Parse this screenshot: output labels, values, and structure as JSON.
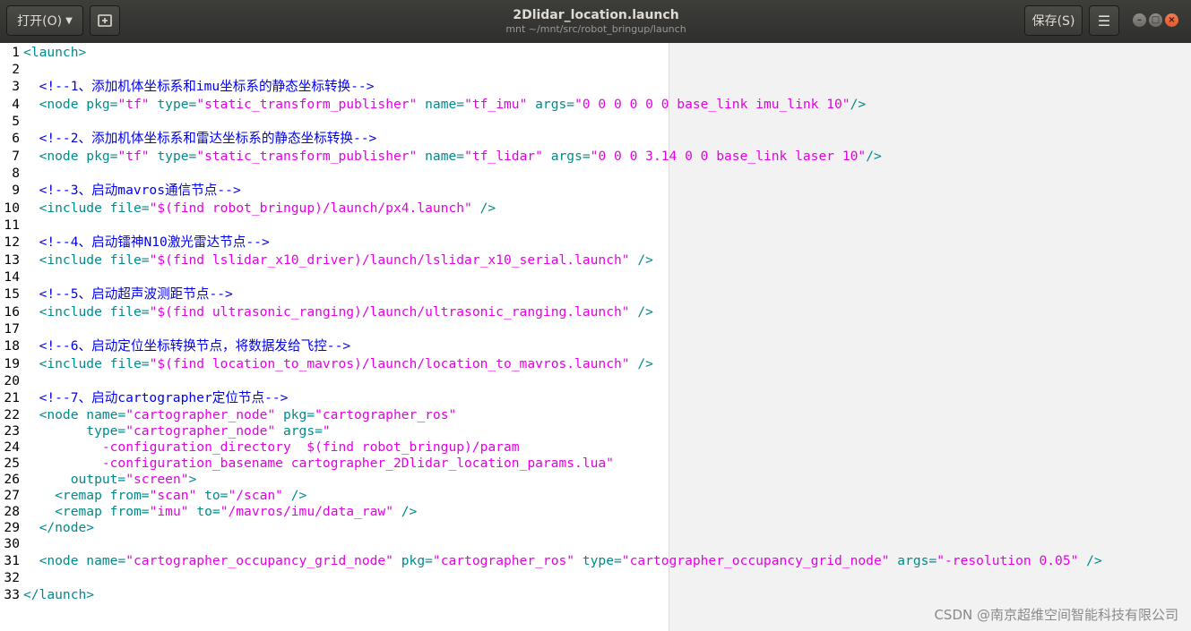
{
  "header": {
    "open_label": "打开(O)",
    "save_label": "保存(S)",
    "title": "2Dlidar_location.launch",
    "subtitle": "mnt ~/mnt/src/robot_bringup/launch"
  },
  "editor": {
    "lines": [
      {
        "n": "1",
        "h": "full",
        "segs": [
          [
            "tag",
            "<launch>"
          ]
        ]
      },
      {
        "n": "2",
        "h": "half",
        "segs": []
      },
      {
        "n": "3",
        "h": "full",
        "segs": [
          [
            "tag",
            "  "
          ],
          [
            "com",
            "<!--1、添加机体坐标系和imu坐标系的静态坐标转换-->"
          ]
        ]
      },
      {
        "n": "4",
        "h": "full",
        "segs": [
          [
            "tag",
            "  <node "
          ],
          [
            "attr",
            "pkg="
          ],
          [
            "str",
            "\"tf\""
          ],
          [
            "attr",
            " type="
          ],
          [
            "str",
            "\"static_transform_publisher\""
          ],
          [
            "attr",
            " name="
          ],
          [
            "str",
            "\"tf_imu\""
          ],
          [
            "attr",
            " args="
          ],
          [
            "str",
            "\"0 0 0 0 0 0 base_link imu_link 10\""
          ],
          [
            "tag",
            "/>"
          ]
        ]
      },
      {
        "n": "5",
        "h": "half",
        "segs": []
      },
      {
        "n": "6",
        "h": "full",
        "segs": [
          [
            "tag",
            "  "
          ],
          [
            "com",
            "<!--2、添加机体坐标系和雷达坐标系的静态坐标转换-->"
          ]
        ]
      },
      {
        "n": "7",
        "h": "full",
        "segs": [
          [
            "tag",
            "  <node "
          ],
          [
            "attr",
            "pkg="
          ],
          [
            "str",
            "\"tf\""
          ],
          [
            "attr",
            " type="
          ],
          [
            "str",
            "\"static_transform_publisher\""
          ],
          [
            "attr",
            " name="
          ],
          [
            "str",
            "\"tf_lidar\""
          ],
          [
            "attr",
            " args="
          ],
          [
            "str",
            "\"0 0 0 3.14 0 0 base_link laser 10\""
          ],
          [
            "tag",
            "/>"
          ]
        ]
      },
      {
        "n": "8",
        "h": "half",
        "segs": []
      },
      {
        "n": "9",
        "h": "full",
        "segs": [
          [
            "tag",
            "  "
          ],
          [
            "com",
            "<!--3、启动mavros通信节点-->"
          ]
        ]
      },
      {
        "n": "10",
        "h": "full",
        "segs": [
          [
            "tag",
            "  <include "
          ],
          [
            "attr",
            "file="
          ],
          [
            "str",
            "\"$(find robot_bringup)/launch/px4.launch\""
          ],
          [
            "tag",
            " />"
          ]
        ]
      },
      {
        "n": "11",
        "h": "half",
        "segs": []
      },
      {
        "n": "12",
        "h": "full",
        "segs": [
          [
            "tag",
            "  "
          ],
          [
            "com",
            "<!--4、启动镭神N10激光雷达节点-->"
          ]
        ]
      },
      {
        "n": "13",
        "h": "full",
        "segs": [
          [
            "tag",
            "  <include "
          ],
          [
            "attr",
            "file="
          ],
          [
            "str",
            "\"$(find lslidar_x10_driver)/launch/lslidar_x10_serial.launch\""
          ],
          [
            "tag",
            " />"
          ]
        ]
      },
      {
        "n": "14",
        "h": "half",
        "segs": []
      },
      {
        "n": "15",
        "h": "full",
        "segs": [
          [
            "tag",
            "  "
          ],
          [
            "com",
            "<!--5、启动超声波测距节点-->"
          ]
        ]
      },
      {
        "n": "16",
        "h": "full",
        "segs": [
          [
            "tag",
            "  <include "
          ],
          [
            "attr",
            "file="
          ],
          [
            "str",
            "\"$(find ultrasonic_ranging)/launch/ultrasonic_ranging.launch\""
          ],
          [
            "tag",
            " />"
          ]
        ]
      },
      {
        "n": "17",
        "h": "half",
        "segs": []
      },
      {
        "n": "18",
        "h": "full",
        "segs": [
          [
            "tag",
            "  "
          ],
          [
            "com",
            "<!--6、启动定位坐标转换节点，将数据发给飞控-->"
          ]
        ]
      },
      {
        "n": "19",
        "h": "full",
        "segs": [
          [
            "tag",
            "  <include "
          ],
          [
            "attr",
            "file="
          ],
          [
            "str",
            "\"$(find location_to_mavros)/launch/location_to_mavros.launch\""
          ],
          [
            "tag",
            " />"
          ]
        ]
      },
      {
        "n": "20",
        "h": "half",
        "segs": []
      },
      {
        "n": "21",
        "h": "full",
        "segs": [
          [
            "tag",
            "  "
          ],
          [
            "com",
            "<!--7、启动cartographer定位节点-->"
          ]
        ]
      },
      {
        "n": "22",
        "h": "half",
        "segs": [
          [
            "tag",
            "  <node "
          ],
          [
            "attr",
            "name="
          ],
          [
            "str",
            "\"cartographer_node\""
          ],
          [
            "attr",
            " pkg="
          ],
          [
            "str",
            "\"cartographer_ros\""
          ]
        ]
      },
      {
        "n": "23",
        "h": "half",
        "segs": [
          [
            "attr",
            "        type="
          ],
          [
            "str",
            "\"cartographer_node\""
          ],
          [
            "attr",
            " args="
          ],
          [
            "str",
            "\""
          ]
        ]
      },
      {
        "n": "24",
        "h": "half",
        "segs": [
          [
            "str",
            "          -configuration_directory  $(find robot_bringup)/param"
          ]
        ]
      },
      {
        "n": "25",
        "h": "half",
        "segs": [
          [
            "str",
            "          -configuration_basename cartographer_2Dlidar_location_params.lua\""
          ]
        ]
      },
      {
        "n": "26",
        "h": "half",
        "segs": [
          [
            "attr",
            "      output="
          ],
          [
            "str",
            "\"screen\""
          ],
          [
            "tag",
            ">"
          ]
        ]
      },
      {
        "n": "27",
        "h": "half",
        "segs": [
          [
            "tag",
            "    <remap "
          ],
          [
            "attr",
            "from="
          ],
          [
            "str",
            "\"scan\""
          ],
          [
            "attr",
            " to="
          ],
          [
            "str",
            "\"/scan\""
          ],
          [
            "tag",
            " />"
          ]
        ]
      },
      {
        "n": "28",
        "h": "half",
        "segs": [
          [
            "tag",
            "    <remap "
          ],
          [
            "attr",
            "from="
          ],
          [
            "str",
            "\"imu\""
          ],
          [
            "attr",
            " to="
          ],
          [
            "str",
            "\"/mavros/imu/data_raw\""
          ],
          [
            "tag",
            " />"
          ]
        ]
      },
      {
        "n": "29",
        "h": "half",
        "segs": [
          [
            "tag",
            "  </node>"
          ]
        ]
      },
      {
        "n": "30",
        "h": "half",
        "segs": []
      },
      {
        "n": "31",
        "h": "full",
        "segs": [
          [
            "tag",
            "  <node "
          ],
          [
            "attr",
            "name="
          ],
          [
            "str",
            "\"cartographer_occupancy_grid_node\""
          ],
          [
            "attr",
            " pkg="
          ],
          [
            "str",
            "\"cartographer_ros\""
          ],
          [
            "attr",
            " type="
          ],
          [
            "str",
            "\"cartographer_occupancy_grid_node\""
          ],
          [
            "attr",
            " args="
          ],
          [
            "str",
            "\"-resolution 0.05\""
          ],
          [
            "tag",
            " />"
          ]
        ]
      },
      {
        "n": "32",
        "h": "half",
        "segs": []
      },
      {
        "n": "33",
        "h": "full",
        "segs": [
          [
            "tag",
            "</launch>"
          ]
        ]
      }
    ]
  },
  "watermark": "CSDN @南京超维空间智能科技有限公司"
}
